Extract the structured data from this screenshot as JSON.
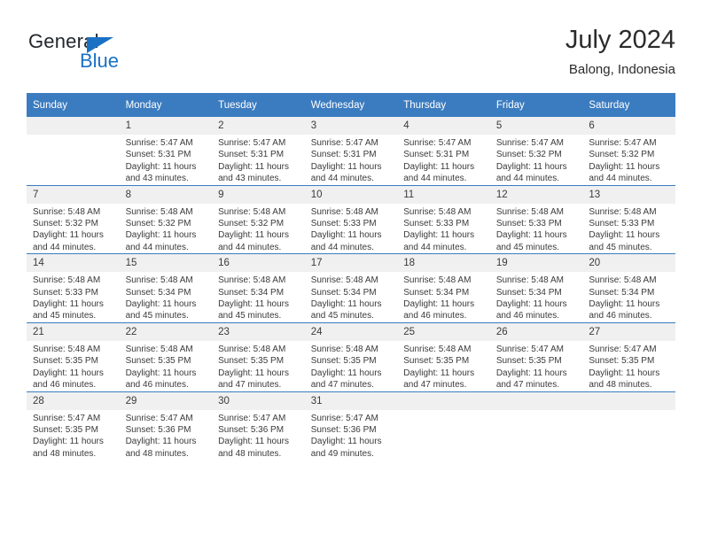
{
  "logo": {
    "word_one": "General",
    "word_two": "Blue",
    "triangle_color": "#1a71c4",
    "text_color": "#23282c"
  },
  "header": {
    "title": "July 2024",
    "subtitle": "Balong, Indonesia",
    "header_bg": "#3b7cc0",
    "daynum_bg": "#f0f0f0"
  },
  "weekday_headers": [
    "Sunday",
    "Monday",
    "Tuesday",
    "Wednesday",
    "Thursday",
    "Friday",
    "Saturday"
  ],
  "weeks": [
    [
      {
        "day": "",
        "blank": true,
        "sunrise": "",
        "sunset": "",
        "daylight_line1": "",
        "daylight_line2": ""
      },
      {
        "day": "1",
        "sunrise": "Sunrise: 5:47 AM",
        "sunset": "Sunset: 5:31 PM",
        "daylight_line1": "Daylight: 11 hours",
        "daylight_line2": "and 43 minutes."
      },
      {
        "day": "2",
        "sunrise": "Sunrise: 5:47 AM",
        "sunset": "Sunset: 5:31 PM",
        "daylight_line1": "Daylight: 11 hours",
        "daylight_line2": "and 43 minutes."
      },
      {
        "day": "3",
        "sunrise": "Sunrise: 5:47 AM",
        "sunset": "Sunset: 5:31 PM",
        "daylight_line1": "Daylight: 11 hours",
        "daylight_line2": "and 44 minutes."
      },
      {
        "day": "4",
        "sunrise": "Sunrise: 5:47 AM",
        "sunset": "Sunset: 5:31 PM",
        "daylight_line1": "Daylight: 11 hours",
        "daylight_line2": "and 44 minutes."
      },
      {
        "day": "5",
        "sunrise": "Sunrise: 5:47 AM",
        "sunset": "Sunset: 5:32 PM",
        "daylight_line1": "Daylight: 11 hours",
        "daylight_line2": "and 44 minutes."
      },
      {
        "day": "6",
        "sunrise": "Sunrise: 5:47 AM",
        "sunset": "Sunset: 5:32 PM",
        "daylight_line1": "Daylight: 11 hours",
        "daylight_line2": "and 44 minutes."
      }
    ],
    [
      {
        "day": "7",
        "sunrise": "Sunrise: 5:48 AM",
        "sunset": "Sunset: 5:32 PM",
        "daylight_line1": "Daylight: 11 hours",
        "daylight_line2": "and 44 minutes."
      },
      {
        "day": "8",
        "sunrise": "Sunrise: 5:48 AM",
        "sunset": "Sunset: 5:32 PM",
        "daylight_line1": "Daylight: 11 hours",
        "daylight_line2": "and 44 minutes."
      },
      {
        "day": "9",
        "sunrise": "Sunrise: 5:48 AM",
        "sunset": "Sunset: 5:32 PM",
        "daylight_line1": "Daylight: 11 hours",
        "daylight_line2": "and 44 minutes."
      },
      {
        "day": "10",
        "sunrise": "Sunrise: 5:48 AM",
        "sunset": "Sunset: 5:33 PM",
        "daylight_line1": "Daylight: 11 hours",
        "daylight_line2": "and 44 minutes."
      },
      {
        "day": "11",
        "sunrise": "Sunrise: 5:48 AM",
        "sunset": "Sunset: 5:33 PM",
        "daylight_line1": "Daylight: 11 hours",
        "daylight_line2": "and 44 minutes."
      },
      {
        "day": "12",
        "sunrise": "Sunrise: 5:48 AM",
        "sunset": "Sunset: 5:33 PM",
        "daylight_line1": "Daylight: 11 hours",
        "daylight_line2": "and 45 minutes."
      },
      {
        "day": "13",
        "sunrise": "Sunrise: 5:48 AM",
        "sunset": "Sunset: 5:33 PM",
        "daylight_line1": "Daylight: 11 hours",
        "daylight_line2": "and 45 minutes."
      }
    ],
    [
      {
        "day": "14",
        "sunrise": "Sunrise: 5:48 AM",
        "sunset": "Sunset: 5:33 PM",
        "daylight_line1": "Daylight: 11 hours",
        "daylight_line2": "and 45 minutes."
      },
      {
        "day": "15",
        "sunrise": "Sunrise: 5:48 AM",
        "sunset": "Sunset: 5:34 PM",
        "daylight_line1": "Daylight: 11 hours",
        "daylight_line2": "and 45 minutes."
      },
      {
        "day": "16",
        "sunrise": "Sunrise: 5:48 AM",
        "sunset": "Sunset: 5:34 PM",
        "daylight_line1": "Daylight: 11 hours",
        "daylight_line2": "and 45 minutes."
      },
      {
        "day": "17",
        "sunrise": "Sunrise: 5:48 AM",
        "sunset": "Sunset: 5:34 PM",
        "daylight_line1": "Daylight: 11 hours",
        "daylight_line2": "and 45 minutes."
      },
      {
        "day": "18",
        "sunrise": "Sunrise: 5:48 AM",
        "sunset": "Sunset: 5:34 PM",
        "daylight_line1": "Daylight: 11 hours",
        "daylight_line2": "and 46 minutes."
      },
      {
        "day": "19",
        "sunrise": "Sunrise: 5:48 AM",
        "sunset": "Sunset: 5:34 PM",
        "daylight_line1": "Daylight: 11 hours",
        "daylight_line2": "and 46 minutes."
      },
      {
        "day": "20",
        "sunrise": "Sunrise: 5:48 AM",
        "sunset": "Sunset: 5:34 PM",
        "daylight_line1": "Daylight: 11 hours",
        "daylight_line2": "and 46 minutes."
      }
    ],
    [
      {
        "day": "21",
        "sunrise": "Sunrise: 5:48 AM",
        "sunset": "Sunset: 5:35 PM",
        "daylight_line1": "Daylight: 11 hours",
        "daylight_line2": "and 46 minutes."
      },
      {
        "day": "22",
        "sunrise": "Sunrise: 5:48 AM",
        "sunset": "Sunset: 5:35 PM",
        "daylight_line1": "Daylight: 11 hours",
        "daylight_line2": "and 46 minutes."
      },
      {
        "day": "23",
        "sunrise": "Sunrise: 5:48 AM",
        "sunset": "Sunset: 5:35 PM",
        "daylight_line1": "Daylight: 11 hours",
        "daylight_line2": "and 47 minutes."
      },
      {
        "day": "24",
        "sunrise": "Sunrise: 5:48 AM",
        "sunset": "Sunset: 5:35 PM",
        "daylight_line1": "Daylight: 11 hours",
        "daylight_line2": "and 47 minutes."
      },
      {
        "day": "25",
        "sunrise": "Sunrise: 5:48 AM",
        "sunset": "Sunset: 5:35 PM",
        "daylight_line1": "Daylight: 11 hours",
        "daylight_line2": "and 47 minutes."
      },
      {
        "day": "26",
        "sunrise": "Sunrise: 5:47 AM",
        "sunset": "Sunset: 5:35 PM",
        "daylight_line1": "Daylight: 11 hours",
        "daylight_line2": "and 47 minutes."
      },
      {
        "day": "27",
        "sunrise": "Sunrise: 5:47 AM",
        "sunset": "Sunset: 5:35 PM",
        "daylight_line1": "Daylight: 11 hours",
        "daylight_line2": "and 48 minutes."
      }
    ],
    [
      {
        "day": "28",
        "sunrise": "Sunrise: 5:47 AM",
        "sunset": "Sunset: 5:35 PM",
        "daylight_line1": "Daylight: 11 hours",
        "daylight_line2": "and 48 minutes."
      },
      {
        "day": "29",
        "sunrise": "Sunrise: 5:47 AM",
        "sunset": "Sunset: 5:36 PM",
        "daylight_line1": "Daylight: 11 hours",
        "daylight_line2": "and 48 minutes."
      },
      {
        "day": "30",
        "sunrise": "Sunrise: 5:47 AM",
        "sunset": "Sunset: 5:36 PM",
        "daylight_line1": "Daylight: 11 hours",
        "daylight_line2": "and 48 minutes."
      },
      {
        "day": "31",
        "sunrise": "Sunrise: 5:47 AM",
        "sunset": "Sunset: 5:36 PM",
        "daylight_line1": "Daylight: 11 hours",
        "daylight_line2": "and 49 minutes."
      },
      {
        "day": "",
        "blank": true,
        "sunrise": "",
        "sunset": "",
        "daylight_line1": "",
        "daylight_line2": ""
      },
      {
        "day": "",
        "blank": true,
        "sunrise": "",
        "sunset": "",
        "daylight_line1": "",
        "daylight_line2": ""
      },
      {
        "day": "",
        "blank": true,
        "sunrise": "",
        "sunset": "",
        "daylight_line1": "",
        "daylight_line2": ""
      }
    ]
  ]
}
